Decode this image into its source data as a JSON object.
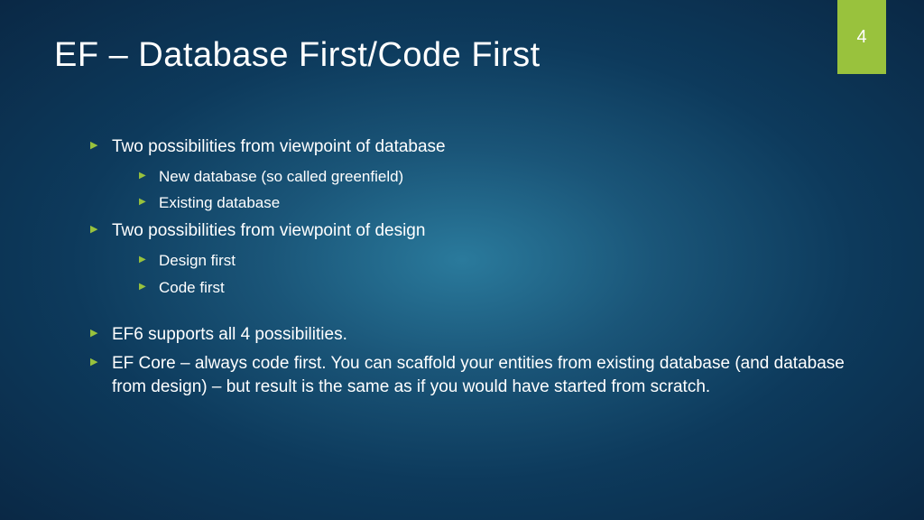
{
  "slide": {
    "page_number": "4",
    "title": "EF – Database First/Code First",
    "bullets_group1": [
      {
        "text": "Two possibilities from viewpoint of database",
        "children": [
          "New database (so called greenfield)",
          "Existing database"
        ]
      },
      {
        "text": "Two possibilities from viewpoint of design",
        "children": [
          "Design first",
          "Code first"
        ]
      }
    ],
    "bullets_group2": [
      {
        "text": "EF6 supports all 4 possibilities.",
        "children": []
      },
      {
        "text": "EF Core – always code first. You can scaffold your entities from existing database (and database from design) – but result is the same as if you would have started from scratch.",
        "children": []
      }
    ]
  },
  "colors": {
    "accent": "#99c23d"
  }
}
